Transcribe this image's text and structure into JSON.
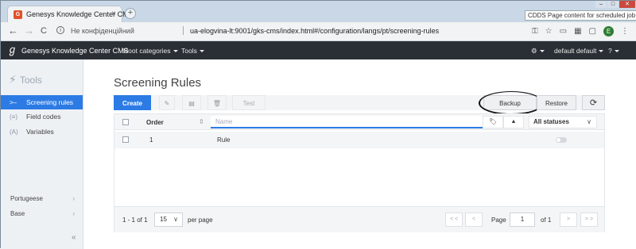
{
  "browser": {
    "tab_title": "Genesys Knowledge Center CMS",
    "tab_close": "×",
    "new_tab": "+",
    "tooltip": "CDDS Page content for scheduled job - R&D",
    "win_min": "–",
    "win_max": "□",
    "win_close": "✕",
    "back": "←",
    "forward": "→",
    "reload": "C",
    "info_icon": "i",
    "security_label": "Не конфіденційний",
    "url": "ua-elogvina-lt:9001/gks-cms/index.html#/configuration/langs/pt/screening-rules",
    "profile_initial": "E",
    "menu_dots": "⋮",
    "key_icon": "⚿",
    "star_icon": "☆"
  },
  "app": {
    "logo_glyph": "ℊ",
    "brand": "Genesys Knowledge Center CMS",
    "menu": [
      "Root categories",
      "Tools"
    ],
    "gear": "⚙",
    "user": "default default",
    "help": "?"
  },
  "sidebar": {
    "title": "Tools",
    "bolt": "⚡",
    "items": [
      {
        "icon": ">–",
        "label": "Screening rules"
      },
      {
        "icon": "(≡)",
        "label": "Field codes"
      },
      {
        "icon": "(A)",
        "label": "Variables"
      }
    ],
    "selectors": [
      {
        "label": "Portugeese",
        "arrow": "›"
      },
      {
        "label": "Base",
        "arrow": "›"
      }
    ],
    "collapse": "«"
  },
  "main": {
    "title": "Screening Rules",
    "buttons": {
      "create": "Create",
      "edit": "✎",
      "doc": "▤",
      "delete": "🗑",
      "test": "Test",
      "backup": "Backup",
      "restore": "Restore",
      "refresh": "⟳"
    },
    "table": {
      "col_order": "Order",
      "sort_icon": "⇕",
      "name_placeholder": "Name",
      "tag_icon": "🏷",
      "sort_arrow": "▲",
      "status_filter": "All statuses",
      "status_dd": "∨",
      "rows": [
        {
          "order": "1",
          "name": "Rule",
          "enabled": false
        }
      ]
    },
    "footer": {
      "range": "1 - 1 of 1",
      "page_size": "15",
      "page_size_dd": "∨",
      "per_page": "per page",
      "first": "< <",
      "prev": "<",
      "page_label": "Page",
      "page_value": "1",
      "of_total": "of 1",
      "next": ">",
      "last": "> >"
    }
  },
  "colors": {
    "accent": "#2c7be5",
    "appbar": "#2a2f35"
  }
}
